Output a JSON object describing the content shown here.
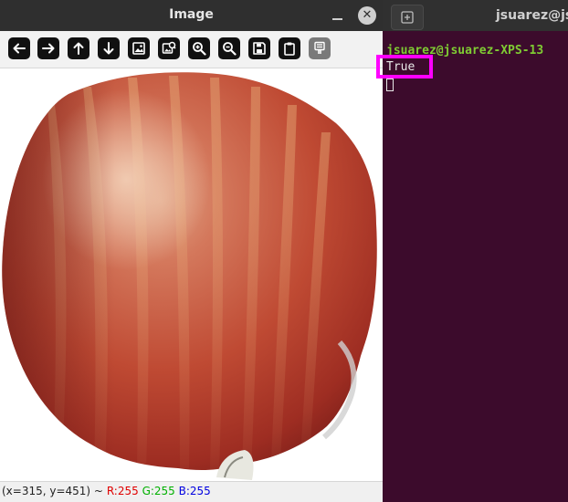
{
  "image_window": {
    "title": "Image",
    "toolbar": [
      {
        "name": "pan-left-icon"
      },
      {
        "name": "pan-right-icon"
      },
      {
        "name": "pan-up-icon"
      },
      {
        "name": "pan-down-icon"
      },
      {
        "name": "zoom-fit-icon"
      },
      {
        "name": "zoom-original-icon"
      },
      {
        "name": "zoom-in-icon"
      },
      {
        "name": "zoom-out-icon"
      },
      {
        "name": "save-icon"
      },
      {
        "name": "clipboard-icon"
      },
      {
        "name": "properties-icon"
      }
    ],
    "status": {
      "coords": "(x=315, y=451) ~",
      "r": "R:255",
      "g": "G:255",
      "b": "B:255"
    }
  },
  "terminal": {
    "title": "jsuarez@js",
    "prompt": "jsuarez@jsuarez-XPS-13",
    "output": "True",
    "colors": {
      "background": "#3c0b2c",
      "prompt": "#7fcc33",
      "highlight": "#ff00ff"
    }
  }
}
